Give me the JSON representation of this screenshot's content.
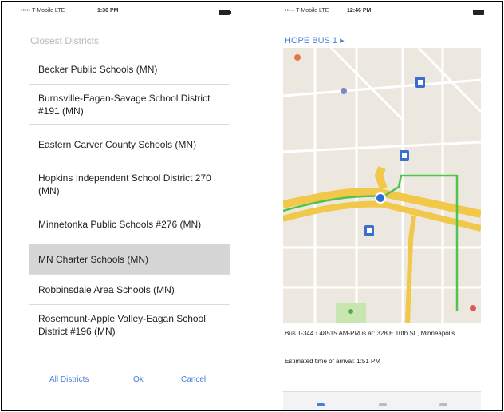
{
  "left": {
    "status": {
      "carrier": "••••◦ T-Mobile  LTE",
      "time": "1:30 PM"
    },
    "section_header": "Closest Districts",
    "districts": [
      "Becker Public Schools (MN)",
      "Burnsville-Eagan-Savage School District #191 (MN)",
      "Eastern Carver County Schools (MN)",
      "Hopkins Independent School District 270 (MN)",
      "Minnetonka Public Schools #276 (MN)",
      "MN Charter Schools (MN)",
      "Robbinsdale Area Schools (MN)",
      "Rosemount-Apple Valley-Eagan School District #196 (MN)"
    ],
    "selected_index": 5,
    "actions": {
      "all": "All Districts",
      "ok": "Ok",
      "cancel": "Cancel"
    },
    "accent_color": "#4a7fd8"
  },
  "right": {
    "status": {
      "carrier": "••◦◦◦ T-Mobile  LTE",
      "time": "12:46 PM"
    },
    "route_title": "HOPE BUS 1 ▸",
    "bus_info": "Bus T-344 › 48515 AM-PM is at: 328 E 10th St., Minneapolis.",
    "eta": "Estimated time of arrival: 1:51 PM",
    "route_color": "#4fc44a",
    "road_color": "#f2c84b"
  }
}
